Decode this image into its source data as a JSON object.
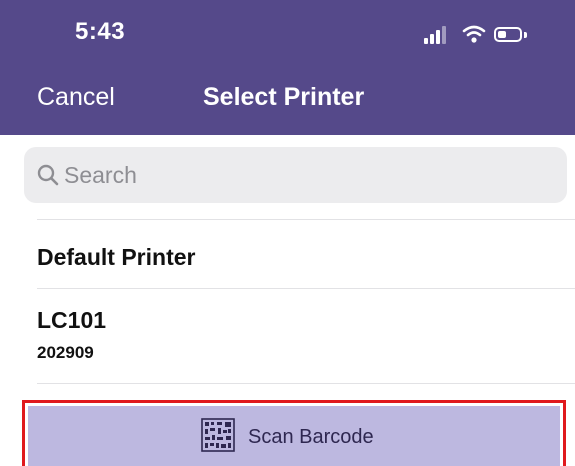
{
  "status_bar": {
    "time": "5:43",
    "icons": [
      "signal-icon",
      "wifi-icon",
      "battery-icon"
    ]
  },
  "nav": {
    "cancel_label": "Cancel",
    "title": "Select Printer"
  },
  "search": {
    "placeholder": "Search",
    "value": ""
  },
  "printers": [
    {
      "name": "Default Printer",
      "id": ""
    },
    {
      "name": "LC101",
      "id": "202909"
    }
  ],
  "scan": {
    "label": "Scan Barcode",
    "icon": "barcode-icon"
  },
  "colors": {
    "header": "#55498a",
    "scan_button": "#bdb8e0",
    "highlight": "#e0191d"
  }
}
